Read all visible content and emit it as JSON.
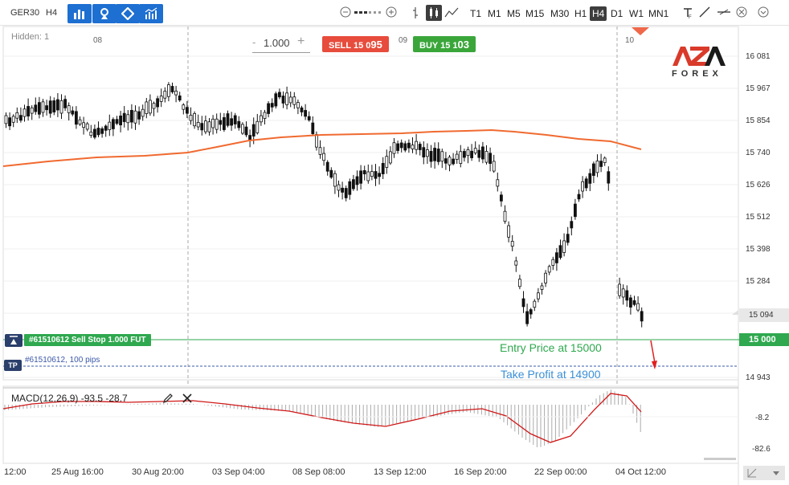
{
  "toolbar": {
    "symbol": "GER30",
    "timeframe": "H4",
    "timeframes": [
      "T1",
      "M1",
      "M5",
      "M15",
      "M30",
      "H1",
      "H4",
      "D1",
      "W1",
      "MN1"
    ],
    "active_timeframe": "H4",
    "tool_icons": [
      "bar-chart-icon",
      "crosshair-icon",
      "diamond-icon",
      "indicators-icon"
    ],
    "right_icons": [
      "zoom-out-icon",
      "zoom-in-icon",
      "candles-icon",
      "line-chart-icon",
      "font-icon",
      "trendline-icon",
      "horizontal-line-icon",
      "close-icon"
    ]
  },
  "chart": {
    "hidden_label": "Hidden: 1",
    "order": {
      "quantity": "1.000",
      "sell_label": "SELL",
      "sell_price_small": "15 0",
      "sell_price_big": "95",
      "buy_label": "BUY",
      "buy_price_small": "15 1",
      "buy_price_big": "03"
    },
    "top_date_labels": [
      "08",
      "09",
      "10"
    ],
    "price_axis": [
      "16 081",
      "15 967",
      "15 854",
      "15 740",
      "15 626",
      "15 512",
      "15 398",
      "15 284",
      "15 094",
      "14 943"
    ],
    "current_price": "15 094",
    "entry_price_tag": "15 000",
    "pending_order_label": "#61510612 Sell Stop 1.000 FUT",
    "tp_icon_label": "TP",
    "tp_label": "#61510612, 100 pips",
    "entry_annotation": "Entry Price at 15000",
    "tp_annotation": "Take Profit at 14900",
    "logo_text_top": "AZA",
    "logo_text_bottom": "FOREX",
    "colors": {
      "moving_average": "#f06a30",
      "entry_line": "#2fa84f",
      "tp_line": "#3a58a8",
      "sell": "#e74c3c",
      "buy": "#3aa63a",
      "arrow": "#e02020"
    }
  },
  "macd": {
    "label": "MACD(12,26,9) -93.5 -28.7",
    "axis": [
      "-8.2",
      "-82.6"
    ],
    "icons": [
      "pencil-icon",
      "close-icon"
    ]
  },
  "x_axis": [
    "12:00",
    "25 Aug 16:00",
    "30 Aug 20:00",
    "03 Sep 04:00",
    "08 Sep 08:00",
    "13 Sep 12:00",
    "16 Sep 20:00",
    "22 Sep 00:00",
    "04 Oct 12:00"
  ]
}
